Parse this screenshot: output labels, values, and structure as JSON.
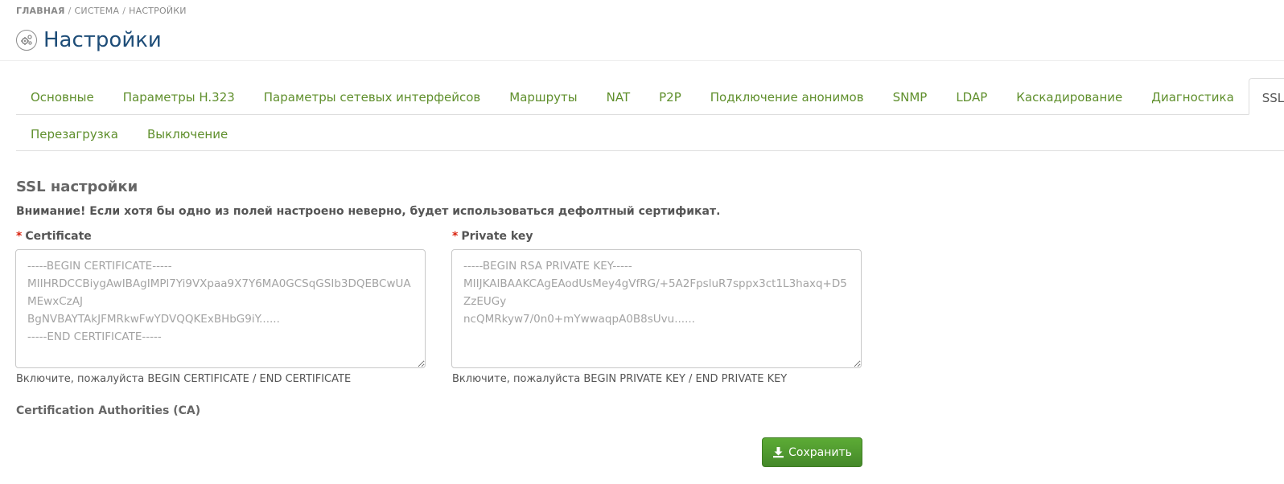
{
  "breadcrumb": {
    "home": "ГЛАВНАЯ",
    "system": "СИСТЕМА",
    "current": "НАСТРОЙКИ",
    "separator": "/"
  },
  "page": {
    "title": "Настройки",
    "icon": "settings-gears-icon"
  },
  "tabs": {
    "row1": [
      {
        "label": "Основные"
      },
      {
        "label": "Параметры H.323"
      },
      {
        "label": "Параметры сетевых интерфейсов"
      },
      {
        "label": "Маршруты"
      },
      {
        "label": "NAT"
      },
      {
        "label": "P2P"
      },
      {
        "label": "Подключение анонимов"
      },
      {
        "label": "SNMP"
      },
      {
        "label": "LDAP"
      },
      {
        "label": "Каскадирование"
      },
      {
        "label": "Диагностика"
      },
      {
        "label": "SSL",
        "active": true
      }
    ],
    "row2": [
      {
        "label": "Перезагрузка"
      },
      {
        "label": "Выключение"
      }
    ]
  },
  "ssl": {
    "title": "SSL настройки",
    "warning": "Внимание! Если хотя бы одно из полей настроено неверно, будет использоваться дефолтный сертификат.",
    "required_mark": "*",
    "certificate": {
      "label": "Certificate",
      "value": "",
      "placeholder": "-----BEGIN CERTIFICATE-----\nMIIHRDCCBiygAwIBAgIMPl7Yi9VXpaa9X7Y6MA0GCSqGSIb3DQEBCwUAMEwxCzAJ\nBgNVBAYTAkJFMRkwFwYDVQQKExBHbG9iY......\n-----END CERTIFICATE-----",
      "help": "Включите, пожалуйста BEGIN CERTIFICATE / END CERTIFICATE"
    },
    "private_key": {
      "label": "Private key",
      "value": "",
      "placeholder": "-----BEGIN RSA PRIVATE KEY-----\nMIIJKAIBAAKCAgEAodUsMey4gVfRG/+5A2FpsluR7sppx3ct1L3haxq+D5ZzEUGy\nncQMRkyw7/0n0+mYwwaqpA0B8sUvu......",
      "help": "Включите, пожалуйста BEGIN PRIVATE KEY / END PRIVATE KEY"
    },
    "ca_label": "Certification Authorities (CA)",
    "save_label": "Сохранить"
  },
  "colors": {
    "tab_link": "#5f8f2c",
    "title": "#1e4d78",
    "button": "#4e9a2d",
    "required": "#d9230f"
  }
}
